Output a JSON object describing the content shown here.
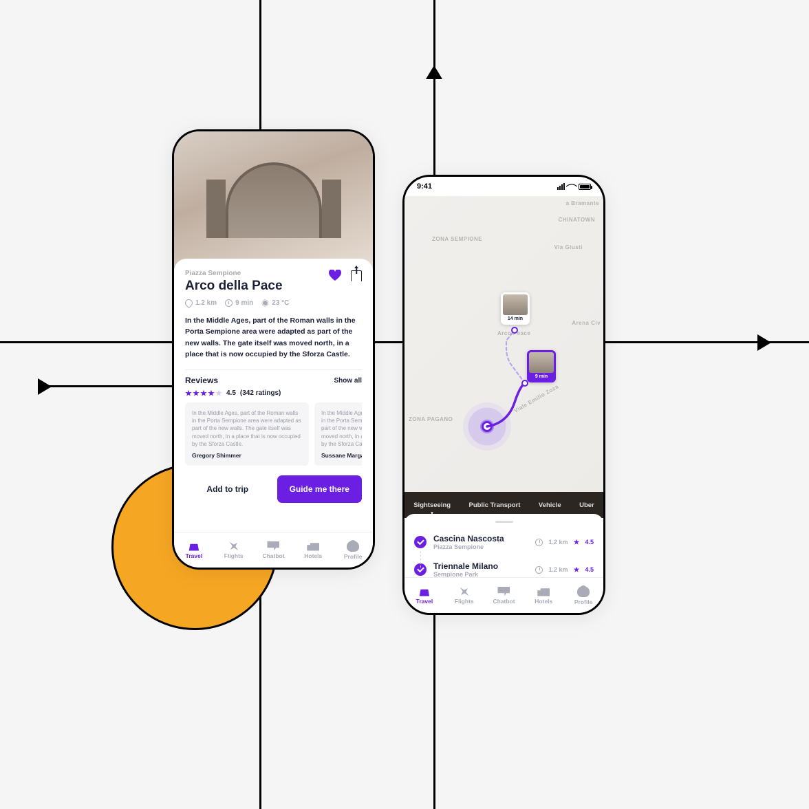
{
  "decor": {
    "circle_color": "#F5A623",
    "axis_color": "#000000"
  },
  "detail": {
    "subtitle": "Piazza Sempione",
    "title": "Arco della Pace",
    "distance": "1.2 km",
    "duration": "9 min",
    "temperature": "23 °C",
    "description": "In the Middle Ages, part of the Roman walls in the Porta Sempione area were adapted as part of the new walls. The gate itself was moved north, in a place that is now occupied by the Sforza Castle.",
    "reviews_title": "Reviews",
    "show_all_label": "Show all",
    "rating_value": "4.5",
    "rating_count_label": "(342 ratings)",
    "stars_filled": 4,
    "reviews": [
      {
        "text": "In the Middle Ages, part of the Roman walls in the Porta Sempione area were adapted as part of the new walls. The gate itself was moved north, in a place that is now occupied by the Sforza Castle.",
        "author": "Gregory Shimmer"
      },
      {
        "text": "In the Middle Ages, part of the Roman walls in the Porta Sempione area were adapted as part of the new walls. The gate itself was moved north, in a place that is now occupied by the Sforza Castle.",
        "author": "Sussane Margaret"
      }
    ],
    "add_to_trip_label": "Add to trip",
    "guide_label": "Guide me there"
  },
  "map": {
    "status_time": "9:41",
    "labels": {
      "zona_sempione": "ZONA SEMPIONE",
      "chinatown": "CHINATOWN",
      "via_giusti": "Via Giusti",
      "zona_pagano": "ZONA PAGANO",
      "arena_civ": "Arena Civ",
      "arco_peace": "Arco Peace",
      "bramante": "a Bramante",
      "viale_zoza": "Viale Emilio Zoza"
    },
    "pin_far_time": "14 min",
    "pin_near_time": "9 min",
    "transport_tabs": [
      "Sightseeing",
      "Public Transport",
      "Vehicle",
      "Uber"
    ],
    "transport_active": 0,
    "stops": [
      {
        "title": "Cascina Nascosta",
        "sub": "Piazza Sempione",
        "distance": "1.2 km",
        "rating": "4.5"
      },
      {
        "title": "Triennale Milano",
        "sub": "Sempione Park",
        "distance": "1.2 km",
        "rating": "4.5"
      }
    ]
  },
  "tabs": [
    {
      "label": "Travel",
      "icon": "travel",
      "active": true
    },
    {
      "label": "Flights",
      "icon": "flights",
      "active": false
    },
    {
      "label": "Chatbot",
      "icon": "chat",
      "active": false
    },
    {
      "label": "Hotels",
      "icon": "hotels",
      "active": false
    },
    {
      "label": "Profile",
      "icon": "profile",
      "active": false
    }
  ],
  "colors": {
    "accent": "#6b1fe3",
    "text": "#1b2036",
    "muted": "#a9acb8"
  }
}
